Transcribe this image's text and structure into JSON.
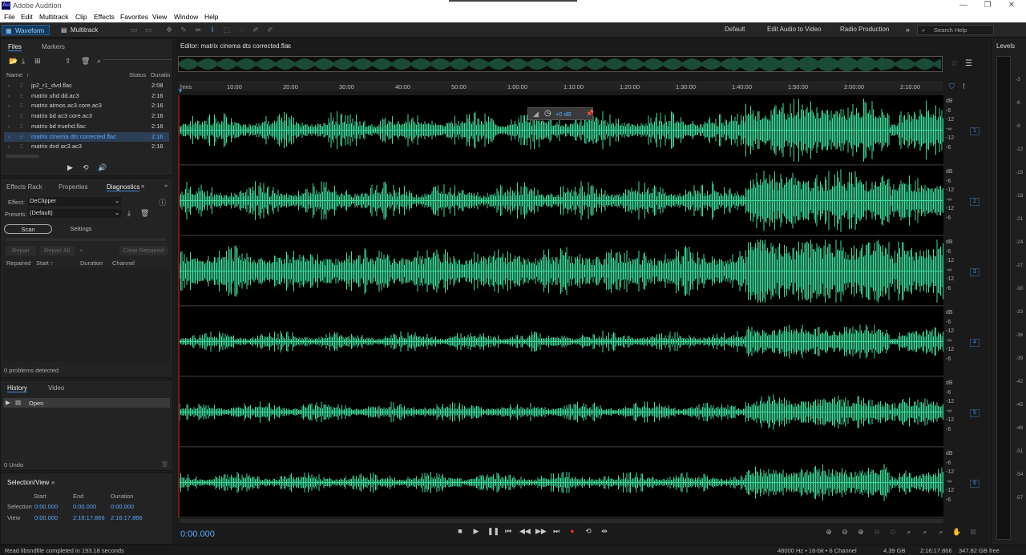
{
  "app": {
    "title": "Adobe Audition",
    "logo": "Au",
    "menu": [
      "File",
      "Edit",
      "Multitrack",
      "Clip",
      "Effects",
      "Favorites",
      "View",
      "Window",
      "Help"
    ]
  },
  "toolbar": {
    "waveform_label": "Waveform",
    "multitrack_label": "Multitrack",
    "workspaces": [
      "Default",
      "Edit Audio to Video",
      "Radio Production"
    ],
    "search_placeholder": "Search Help"
  },
  "files_panel": {
    "tabs": [
      "Files",
      "Markers"
    ],
    "columns": {
      "name": "Name",
      "status": "Status",
      "duration": "Duratio"
    },
    "files": [
      {
        "name": "jp2_r1_dvd.flac",
        "duration": "2:08",
        "selected": false
      },
      {
        "name": "matrix uhd dd.ac3",
        "duration": "2:16",
        "selected": false
      },
      {
        "name": "matrix atmos ac3 core.ac3",
        "duration": "2:16",
        "selected": false
      },
      {
        "name": "matrix bd ac3 core.ac3",
        "duration": "2:16",
        "selected": false
      },
      {
        "name": "matrix bd truehd.flac",
        "duration": "2:16",
        "selected": false
      },
      {
        "name": "matrix cinema dts corrected.flac",
        "duration": "2:16",
        "selected": true
      },
      {
        "name": "matrix dvd ac3.ac3",
        "duration": "2:16",
        "selected": false
      }
    ]
  },
  "diagnostics_panel": {
    "tabs": [
      "Effects Rack",
      "Properties",
      "Diagnostics"
    ],
    "effect_label": "Effect:",
    "effect_value": "DeClipper",
    "presets_label": "Presets:",
    "presets_value": "(Default)",
    "scan_label": "Scan",
    "settings_label": "Settings",
    "repair_label": "Repair",
    "repair_all_label": "Repair All",
    "clear_repaired_label": "Clear Repaired",
    "columns": [
      "Repaired",
      "Start",
      "Duration",
      "Channel"
    ],
    "status": "0 problems detected."
  },
  "history_panel": {
    "tabs": [
      "History",
      "Video"
    ],
    "items": [
      "Open"
    ],
    "undo_count": "0 Undo"
  },
  "selection_view": {
    "title": "Selection/View",
    "headers": [
      "Start",
      "End",
      "Duration"
    ],
    "selection_label": "Selection",
    "selection": [
      "0:00.000",
      "0:00.000",
      "0:00.000"
    ],
    "view_label": "View",
    "view": [
      "0:00.000",
      "2:16:17.866",
      "2:16:17.866"
    ]
  },
  "editor": {
    "title": "Editor: matrix cinema dts corrected.flac",
    "ruler_unit": "hms",
    "ruler_ticks": [
      "10:00",
      "20:00",
      "30:00",
      "40:00",
      "50:00",
      "1:00:00",
      "1:10:00",
      "1:20:00",
      "1:30:00",
      "1:40:00",
      "1:50:00",
      "2:00:00",
      "2:10:00"
    ],
    "hud_gain": "+0 dB",
    "db_labels": [
      "dB",
      "-6",
      "-12",
      "-∞",
      "-12",
      "-6"
    ],
    "channels": [
      "1",
      "2",
      "3",
      "4",
      "5",
      "6"
    ],
    "current_time": "0:00.000",
    "waveform_color": "#3ddc9a"
  },
  "levels_panel": {
    "title": "Levels",
    "scale": [
      "-3",
      "-6",
      "-9",
      "-12",
      "-15",
      "-18",
      "-21",
      "-24",
      "-27",
      "-30",
      "-33",
      "-36",
      "-39",
      "-42",
      "-45",
      "-48",
      "-51",
      "-54",
      "-57"
    ]
  },
  "status_bar": {
    "message": "Read libsndfile completed in 193.18 seconds",
    "format": "48000 Hz • 16-bit • 6 Channel",
    "size": "4.39 GB",
    "duration": "2:16:17.866",
    "free": "347.82 GB free"
  }
}
